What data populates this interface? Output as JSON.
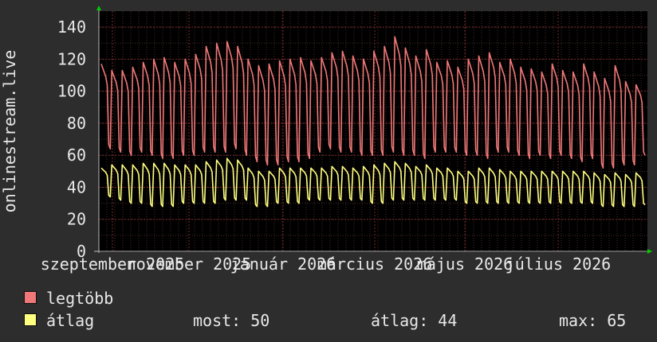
{
  "chart_data": {
    "type": "line",
    "ylabel": "onlinestream.live",
    "ylim": [
      0,
      150
    ],
    "yticks": [
      0,
      20,
      40,
      60,
      80,
      100,
      120,
      140
    ],
    "x_tick_labels": [
      "szeptember 2025",
      "november 2025",
      "január 2026",
      "március 2026",
      "május 2026",
      "július 2026"
    ],
    "grid": true,
    "series": [
      {
        "name": "legtöbb",
        "color": "#f07878",
        "weekly_high": [
          117,
          113,
          113,
          115,
          118,
          120,
          121,
          118,
          120,
          123,
          128,
          130,
          131,
          128,
          120,
          116,
          117,
          119,
          120,
          121,
          119,
          121,
          124,
          125,
          122,
          120,
          125,
          128,
          134,
          127,
          122,
          126,
          118,
          119,
          115,
          120,
          122,
          124,
          118,
          120,
          115,
          114,
          112,
          117,
          113,
          112,
          117,
          112,
          108,
          116,
          106,
          104
        ],
        "weekly_low": [
          64,
          62,
          60,
          62,
          60,
          58,
          58,
          60,
          60,
          62,
          62,
          62,
          64,
          60,
          56,
          54,
          54,
          56,
          56,
          58,
          62,
          64,
          62,
          62,
          60,
          60,
          60,
          62,
          60,
          60,
          58,
          62,
          62,
          62,
          60,
          60,
          58,
          62,
          62,
          60,
          58,
          60,
          58,
          60,
          58,
          56,
          58,
          52,
          52,
          54,
          54,
          60
        ]
      },
      {
        "name": "átlag",
        "color": "#ffff80",
        "weekly_high": [
          52,
          54,
          54,
          54,
          55,
          55,
          55,
          54,
          54,
          54,
          56,
          57,
          58,
          57,
          52,
          50,
          50,
          52,
          52,
          52,
          52,
          52,
          53,
          53,
          52,
          53,
          54,
          55,
          56,
          55,
          53,
          54,
          52,
          52,
          50,
          50,
          52,
          52,
          51,
          50,
          50,
          50,
          50,
          50,
          50,
          50,
          50,
          49,
          48,
          49,
          48,
          49
        ],
        "weekly_low": [
          34,
          32,
          30,
          30,
          28,
          28,
          28,
          30,
          30,
          30,
          30,
          32,
          32,
          32,
          28,
          28,
          30,
          30,
          30,
          32,
          32,
          32,
          32,
          32,
          32,
          30,
          30,
          32,
          32,
          32,
          32,
          32,
          32,
          32,
          30,
          30,
          30,
          30,
          30,
          30,
          30,
          30,
          30,
          30,
          30,
          30,
          30,
          28,
          28,
          28,
          28,
          29
        ]
      }
    ]
  },
  "legend": {
    "max_label": "legtöbb",
    "avg_label": "átlag",
    "stats": {
      "now": "most: 50",
      "avg": "átlag: 44",
      "max": "max: 65"
    }
  }
}
